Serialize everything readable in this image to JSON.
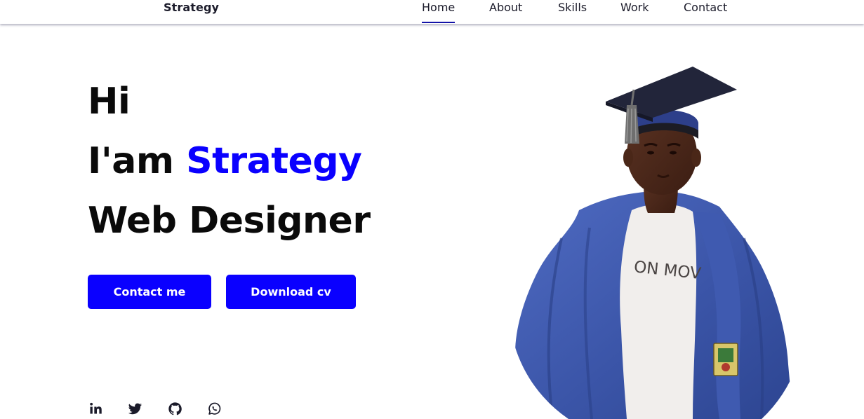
{
  "header": {
    "logo": "Strategy",
    "nav": [
      {
        "label": "Home",
        "active": true
      },
      {
        "label": "About",
        "active": false
      },
      {
        "label": "Skills",
        "active": false
      },
      {
        "label": "Work",
        "active": false
      },
      {
        "label": "Contact",
        "active": false
      }
    ]
  },
  "hero": {
    "greeting": "Hi",
    "intro_prefix": "I'am",
    "name": "Strategy",
    "role": "Web Designer",
    "buttons": {
      "contact": "Contact me",
      "download": "Download cv"
    },
    "photo_shirt_text": "ON MOV"
  },
  "socials": [
    {
      "icon": "linkedin-icon"
    },
    {
      "icon": "twitter-icon"
    },
    {
      "icon": "github-icon"
    },
    {
      "icon": "whatsapp-icon"
    }
  ],
  "colors": {
    "accent": "#0a00ff",
    "text": "#0a0a0a",
    "nav_text": "#1b1b2a",
    "nav_underline": "#1313a8",
    "background": "#ffffff"
  }
}
